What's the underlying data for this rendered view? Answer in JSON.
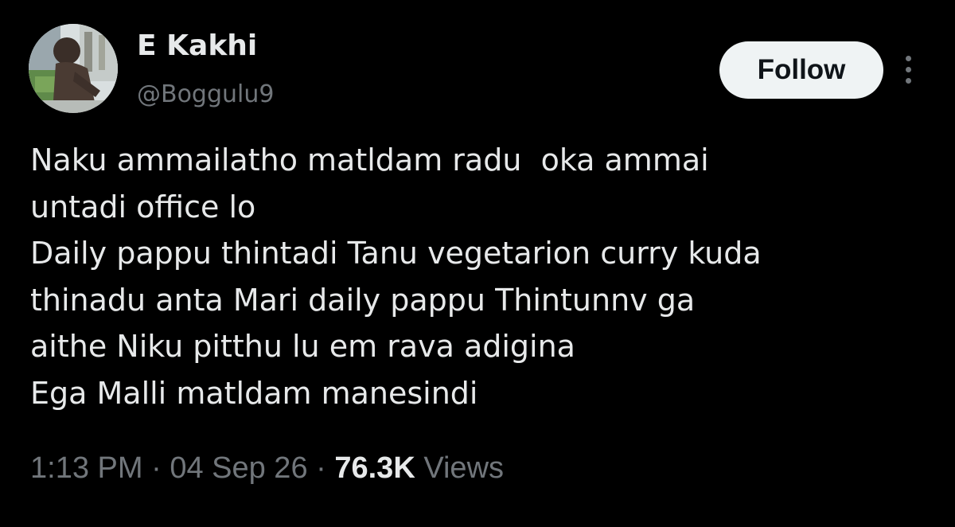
{
  "author": {
    "name": "E Kakhi",
    "handle": "@Boggulu9",
    "avatar_icon": "profile-photo"
  },
  "actions": {
    "follow_label": "Follow",
    "more_icon": "more-vertical-icon"
  },
  "tweet": {
    "lines": [
      "Naku ammailatho matldam radu  oka ammai",
      "untadi office lo",
      "Daily pappu thintadi Tanu vegetarion curry kuda",
      "thinadu anta Mari daily pappu Thintunnv ga",
      "aithe Niku pitthu lu em rava adigina",
      "Ega Malli matldam manesindi"
    ]
  },
  "meta": {
    "time": "1:13 PM",
    "separator": " · ",
    "date": "04 Sep 26",
    "views_count": "76.3K",
    "views_label": "Views"
  },
  "colors": {
    "background": "#000000",
    "text_primary": "#e7e9ea",
    "text_secondary": "#71767b",
    "follow_bg": "#eff3f4",
    "follow_text": "#0f1419"
  }
}
